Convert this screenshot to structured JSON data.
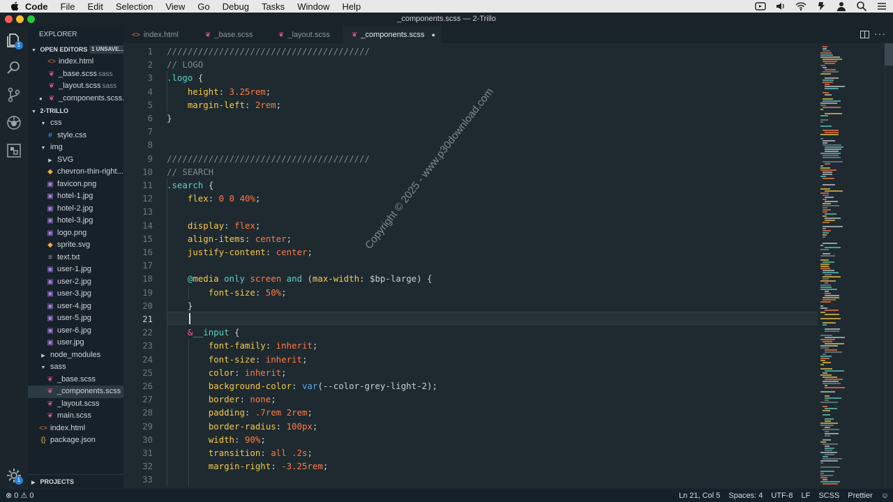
{
  "menubar": {
    "app": "Code",
    "menus": [
      "File",
      "Edit",
      "Selection",
      "View",
      "Go",
      "Debug",
      "Tasks",
      "Window",
      "Help"
    ]
  },
  "window": {
    "title": "_components.scss — 2-Trillo"
  },
  "activity": {
    "explorer_badge": "1",
    "settings_badge": "1"
  },
  "sidebar": {
    "title": "EXPLORER",
    "open_editors_label": "OPEN EDITORS",
    "unsaved_label": "1 UNSAVE...",
    "open_editors": [
      {
        "name": "index.html",
        "hint": "",
        "icon": "html"
      },
      {
        "name": "_base.scss",
        "hint": "sass",
        "icon": "scss"
      },
      {
        "name": "_layout.scss",
        "hint": "sass",
        "icon": "scss"
      },
      {
        "name": "_components.scss...",
        "hint": "",
        "icon": "scss"
      }
    ],
    "project_label": "2-TRILLO",
    "tree": [
      {
        "name": "css",
        "type": "folder-open",
        "depth": 0
      },
      {
        "name": "style.css",
        "type": "css",
        "depth": 1
      },
      {
        "name": "img",
        "type": "folder-open",
        "depth": 0
      },
      {
        "name": "SVG",
        "type": "folder",
        "depth": 1
      },
      {
        "name": "chevron-thin-right...",
        "type": "svg",
        "depth": 1
      },
      {
        "name": "favicon.png",
        "type": "img",
        "depth": 1
      },
      {
        "name": "hotel-1.jpg",
        "type": "img",
        "depth": 1
      },
      {
        "name": "hotel-2.jpg",
        "type": "img",
        "depth": 1
      },
      {
        "name": "hotel-3.jpg",
        "type": "img",
        "depth": 1
      },
      {
        "name": "logo.png",
        "type": "img",
        "depth": 1
      },
      {
        "name": "sprite.svg",
        "type": "svg",
        "depth": 1
      },
      {
        "name": "text.txt",
        "type": "txt",
        "depth": 1
      },
      {
        "name": "user-1.jpg",
        "type": "img",
        "depth": 1
      },
      {
        "name": "user-2.jpg",
        "type": "img",
        "depth": 1
      },
      {
        "name": "user-3.jpg",
        "type": "img",
        "depth": 1
      },
      {
        "name": "user-4.jpg",
        "type": "img",
        "depth": 1
      },
      {
        "name": "user-5.jpg",
        "type": "img",
        "depth": 1
      },
      {
        "name": "user-6.jpg",
        "type": "img",
        "depth": 1
      },
      {
        "name": "user.jpg",
        "type": "img",
        "depth": 1
      },
      {
        "name": "node_modules",
        "type": "folder",
        "depth": 0
      },
      {
        "name": "sass",
        "type": "folder-open",
        "depth": 0
      },
      {
        "name": "_base.scss",
        "type": "scss",
        "depth": 1
      },
      {
        "name": "_components.scss",
        "type": "scss",
        "depth": 1,
        "selected": true
      },
      {
        "name": "_layout.scss",
        "type": "scss",
        "depth": 1
      },
      {
        "name": "main.scss",
        "type": "scss",
        "depth": 1
      },
      {
        "name": "index.html",
        "type": "html",
        "depth": 0
      },
      {
        "name": "package.json",
        "type": "json",
        "depth": 0
      }
    ],
    "projects_label": "PROJECTS"
  },
  "tabs": [
    {
      "name": "index.html",
      "icon": "html",
      "active": false
    },
    {
      "name": "_base.scss",
      "icon": "scss",
      "active": false
    },
    {
      "name": "_layout.scss",
      "icon": "scss",
      "active": false
    },
    {
      "name": "_components.scss",
      "icon": "scss",
      "active": true,
      "dirty": true
    }
  ],
  "editor": {
    "current_line": 21,
    "lines": [
      [
        [
          "com",
          "///////////////////////////////////////"
        ]
      ],
      [
        [
          "com",
          "// LOGO"
        ]
      ],
      [
        [
          "sel",
          ".logo "
        ],
        [
          "pun",
          "{"
        ]
      ],
      [
        [
          "pun",
          "    "
        ],
        [
          "prop",
          "height"
        ],
        [
          "pun",
          ": "
        ],
        [
          "val",
          "3.25rem"
        ],
        [
          "pun",
          ";"
        ]
      ],
      [
        [
          "pun",
          "    "
        ],
        [
          "prop",
          "margin-left"
        ],
        [
          "pun",
          ": "
        ],
        [
          "val",
          "2rem"
        ],
        [
          "pun",
          ";"
        ]
      ],
      [
        [
          "pun",
          "}"
        ]
      ],
      [],
      [],
      [
        [
          "com",
          "///////////////////////////////////////"
        ]
      ],
      [
        [
          "com",
          "// SEARCH"
        ]
      ],
      [
        [
          "sel",
          ".search "
        ],
        [
          "pun",
          "{"
        ]
      ],
      [
        [
          "pun",
          "    "
        ],
        [
          "prop",
          "flex"
        ],
        [
          "pun",
          ": "
        ],
        [
          "val",
          "0 0 40%"
        ],
        [
          "pun",
          ";"
        ]
      ],
      [],
      [
        [
          "pun",
          "    "
        ],
        [
          "prop",
          "display"
        ],
        [
          "pun",
          ": "
        ],
        [
          "val",
          "flex"
        ],
        [
          "pun",
          ";"
        ]
      ],
      [
        [
          "pun",
          "    "
        ],
        [
          "prop",
          "align-items"
        ],
        [
          "pun",
          ": "
        ],
        [
          "val",
          "center"
        ],
        [
          "pun",
          ";"
        ]
      ],
      [
        [
          "pun",
          "    "
        ],
        [
          "prop",
          "justify-content"
        ],
        [
          "pun",
          ": "
        ],
        [
          "val",
          "center"
        ],
        [
          "pun",
          ";"
        ]
      ],
      [],
      [
        [
          "pun",
          "    "
        ],
        [
          "kw",
          "@"
        ],
        [
          "prop",
          "media "
        ],
        [
          "kw",
          "only "
        ],
        [
          "val",
          "screen "
        ],
        [
          "kw",
          "and "
        ],
        [
          "pun",
          "("
        ],
        [
          "prop",
          "max-width"
        ],
        [
          "pun",
          ": $bp-large) {"
        ]
      ],
      [
        [
          "pun",
          "        "
        ],
        [
          "prop",
          "font-size"
        ],
        [
          "pun",
          ": "
        ],
        [
          "val",
          "50%"
        ],
        [
          "pun",
          ";"
        ]
      ],
      [
        [
          "pun",
          "    }"
        ]
      ],
      [],
      [
        [
          "pun",
          "    "
        ],
        [
          "amp",
          "&"
        ],
        [
          "sel",
          "__input "
        ],
        [
          "pun",
          "{"
        ]
      ],
      [
        [
          "pun",
          "        "
        ],
        [
          "prop",
          "font-family"
        ],
        [
          "pun",
          ": "
        ],
        [
          "val",
          "inherit"
        ],
        [
          "pun",
          ";"
        ]
      ],
      [
        [
          "pun",
          "        "
        ],
        [
          "prop",
          "font-size"
        ],
        [
          "pun",
          ": "
        ],
        [
          "val",
          "inherit"
        ],
        [
          "pun",
          ";"
        ]
      ],
      [
        [
          "pun",
          "        "
        ],
        [
          "prop",
          "color"
        ],
        [
          "pun",
          ": "
        ],
        [
          "val",
          "inherit"
        ],
        [
          "pun",
          ";"
        ]
      ],
      [
        [
          "pun",
          "        "
        ],
        [
          "prop",
          "background-color"
        ],
        [
          "pun",
          ": "
        ],
        [
          "fn",
          "var"
        ],
        [
          "pun",
          "(--color-grey-light-2);"
        ]
      ],
      [
        [
          "pun",
          "        "
        ],
        [
          "prop",
          "border"
        ],
        [
          "pun",
          ": "
        ],
        [
          "val",
          "none"
        ],
        [
          "pun",
          ";"
        ]
      ],
      [
        [
          "pun",
          "        "
        ],
        [
          "prop",
          "padding"
        ],
        [
          "pun",
          ": "
        ],
        [
          "val",
          ".7rem 2rem"
        ],
        [
          "pun",
          ";"
        ]
      ],
      [
        [
          "pun",
          "        "
        ],
        [
          "prop",
          "border-radius"
        ],
        [
          "pun",
          ": "
        ],
        [
          "val",
          "100px"
        ],
        [
          "pun",
          ";"
        ]
      ],
      [
        [
          "pun",
          "        "
        ],
        [
          "prop",
          "width"
        ],
        [
          "pun",
          ": "
        ],
        [
          "val",
          "90%"
        ],
        [
          "pun",
          ";"
        ]
      ],
      [
        [
          "pun",
          "        "
        ],
        [
          "prop",
          "transition"
        ],
        [
          "pun",
          ": "
        ],
        [
          "val",
          "all .2s"
        ],
        [
          "pun",
          ";"
        ]
      ],
      [
        [
          "pun",
          "        "
        ],
        [
          "prop",
          "margin-right"
        ],
        [
          "pun",
          ": "
        ],
        [
          "val",
          "-3.25rem"
        ],
        [
          "pun",
          ";"
        ]
      ],
      []
    ]
  },
  "watermark": "Copyright © 2025 - www.p30download.com",
  "statusbar": {
    "errors": "0",
    "warnings": "0",
    "position": "Ln 21, Col 5",
    "spaces": "Spaces: 4",
    "encoding": "UTF-8",
    "eol": "LF",
    "language": "SCSS",
    "formatter": "Prettier"
  },
  "colors": {
    "comment": "#7c8a91",
    "selector": "#5fd0c5",
    "property": "#f7c948",
    "value": "#ff7a45",
    "function": "#56a8e8",
    "ampersand": "#ff5c8a"
  }
}
